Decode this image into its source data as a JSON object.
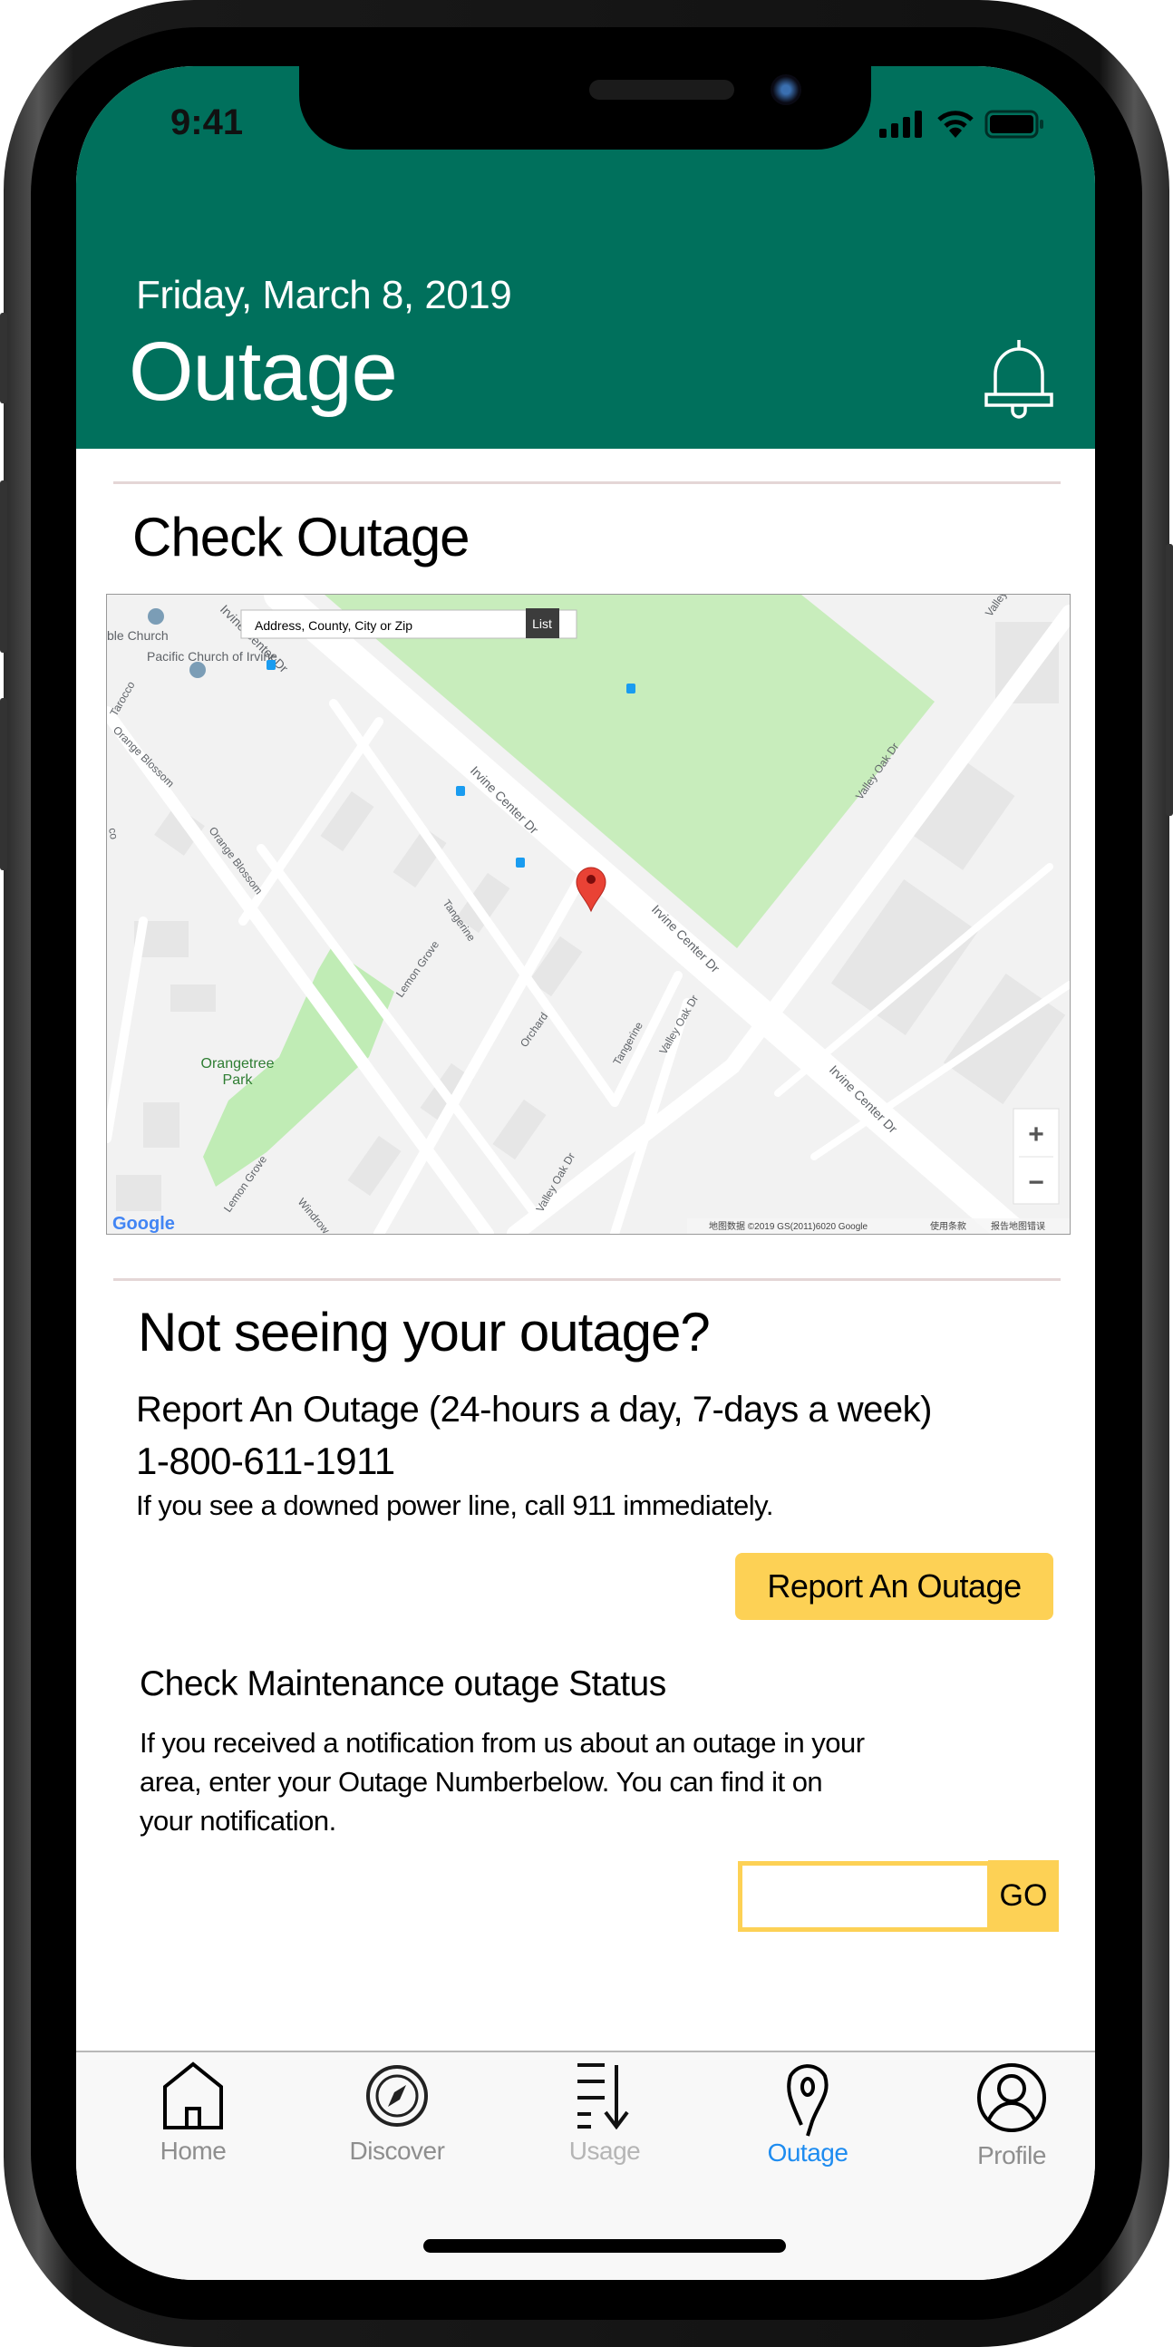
{
  "status_bar": {
    "time": "9:41"
  },
  "header": {
    "date": "Friday, March 8, 2019",
    "title": "Outage",
    "bell_icon": "bell-icon"
  },
  "check_outage": {
    "heading": "Check Outage",
    "map": {
      "search_placeholder": "Address, County, City or Zip",
      "list_button": "List",
      "zoom_in": "+",
      "zoom_out": "−",
      "attribution": "地图数据 ©2019 GS(2011)6020 Google",
      "terms": "使用条款",
      "report_error": "报告地图错误",
      "labels": {
        "church1": "ble Church",
        "church2": "Pacific Church of Irvine",
        "tarocco": "Tarocco",
        "orange_blossom1": "Orange Blossom",
        "orange_blossom2": "Orange Blossom",
        "irvine1": "Irvine Center Dr",
        "irvine2": "Irvine Center Dr",
        "irvine3": "Irvine Center Dr",
        "irvine4": "Irvine Center Dr",
        "tangerine1": "Tangerine",
        "tangerine2": "Tangerine",
        "lemon1": "Lemon Grove",
        "lemon2": "Lemon Grove",
        "orchard": "Orchard",
        "valley1": "Valley Oak Dr",
        "valley2": "Valley Oak Dr",
        "valley3": "Valley Oak Dr",
        "valley4": "Valley Oa",
        "park1": "Orangetree",
        "park2": "Park",
        "windrow": "Windrow",
        "co": "co",
        "google": "Google"
      }
    }
  },
  "not_seeing": {
    "heading": "Not seeing your outage?",
    "report_line": "Report An Outage (24-hours a day, 7-days a week)",
    "phone": "1-800-611-1911",
    "warning": "If you see a downed power line, call 911 immediately.",
    "report_button": "Report An Outage"
  },
  "maintenance": {
    "heading": "Check Maintenance outage Status",
    "line1": "If you received a notification from us about an outage in your",
    "line2": "area, enter your Outage Numberbelow. You can find it on",
    "line3": "your notification.",
    "input_value": "",
    "go_button": "GO"
  },
  "tabs": [
    {
      "label": "Home",
      "icon": "home-icon"
    },
    {
      "label": "Discover",
      "icon": "compass-icon"
    },
    {
      "label": "Usage",
      "icon": "usage-list-icon"
    },
    {
      "label": "Outage",
      "icon": "location-pin-icon",
      "active": true
    },
    {
      "label": "Profile",
      "icon": "profile-icon"
    }
  ],
  "colors": {
    "brand_green": "#00705c",
    "accent_yellow": "#fdd155",
    "active_tab": "#1e8cf0",
    "pin_red": "#e94235",
    "park_green": "#c8edbc"
  }
}
